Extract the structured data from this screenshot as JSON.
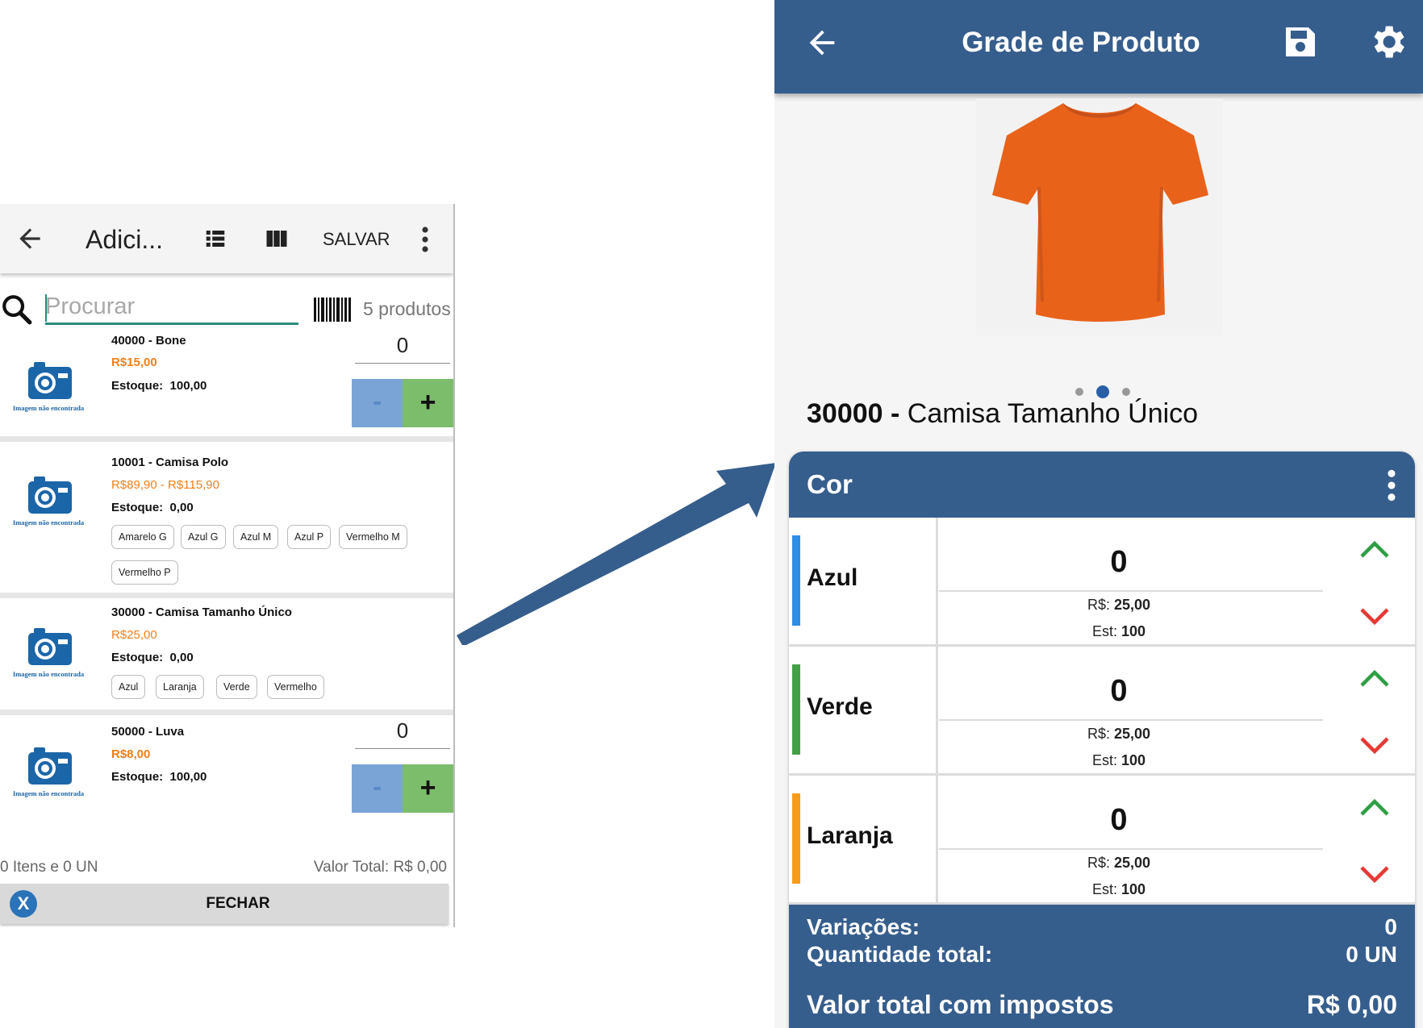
{
  "left": {
    "toolbar": {
      "title": "Adici...",
      "save_label": "SALVAR"
    },
    "search": {
      "placeholder": "Procurar",
      "count": "5 produtos"
    },
    "image_caption": "Imagem não encontrada",
    "products": [
      {
        "name": "40000 - Bone",
        "price": "R$15,00",
        "stock_label": "Estoque:",
        "stock": "100,00",
        "qty": "0"
      },
      {
        "name": "10001 - Camisa Polo",
        "price": "R$89,90 - R$115,90",
        "stock_label": "Estoque:",
        "stock": "0,00",
        "chips": [
          "Amarelo G",
          "Azul G",
          "Azul M",
          "Azul P",
          "Vermelho M",
          "Vermelho P"
        ]
      },
      {
        "name": "30000 - Camisa Tamanho Único",
        "price": "R$25,00",
        "stock_label": "Estoque:",
        "stock": "0,00",
        "chips": [
          "Azul",
          "Laranja",
          "Verde",
          "Vermelho"
        ]
      },
      {
        "name": "50000 - Luva",
        "price": "R$8,00",
        "stock_label": "Estoque:",
        "stock": "100,00",
        "qty": "0"
      }
    ],
    "minus_label": "-",
    "plus_label": "+",
    "footer": {
      "items": "0 Itens e 0 UN",
      "total": "Valor Total: R$ 0,00"
    },
    "close": {
      "x": "X",
      "label": "FECHAR"
    }
  },
  "right": {
    "toolbar": {
      "title": "Grade de Produto"
    },
    "product": {
      "code": "30000",
      "sep": " - ",
      "name": "Camisa Tamanho Único"
    },
    "group": {
      "title": "Cor"
    },
    "variants": [
      {
        "name": "Azul",
        "qty": "0",
        "price_label": "R$:",
        "price": "25,00",
        "stock_label": "Est:",
        "stock": "100",
        "color": "#2f8ee6"
      },
      {
        "name": "Verde",
        "qty": "0",
        "price_label": "R$:",
        "price": "25,00",
        "stock_label": "Est:",
        "stock": "100",
        "color": "#43a047"
      },
      {
        "name": "Laranja",
        "qty": "0",
        "price_label": "R$:",
        "price": "25,00",
        "stock_label": "Est:",
        "stock": "100",
        "color": "#f59c1a"
      }
    ],
    "summary": {
      "variations_label": "Variações:",
      "variations": "0",
      "total_qty_label": "Quantidade total:",
      "total_qty": "0 UN",
      "total_value_label": "Valor total com impostos",
      "total_value": "R$ 0,00"
    }
  },
  "colors": {
    "header_blue": "#365e8c",
    "price_orange": "#f0801c",
    "up_green": "#2e9e44",
    "down_red": "#e53935"
  }
}
